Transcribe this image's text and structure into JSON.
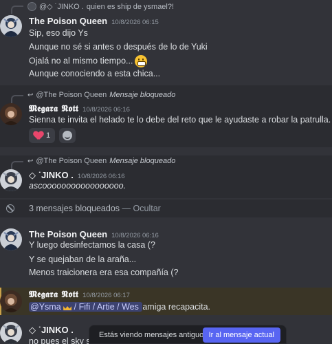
{
  "messages": {
    "m1": {
      "reply_author": "@◇ ˙JINKO .",
      "reply_text": "quien es ship de ysmael?!",
      "author": "The Poison Queen",
      "timestamp": "10/8/2026 06:15",
      "lines": [
        "Sip, eso dijo Ys",
        "Aunque no sé si antes o después de lo de Yuki",
        "Ojalá no al mismo tiempo...",
        "Aunque conociendo a esta chica..."
      ],
      "emoji": "grimacing-face"
    },
    "m2": {
      "reply_author": "@The Poison Queen",
      "reply_text": "Mensaje bloqueado",
      "author": "𝕸𝖊𝖌𝖆𝖗𝖆 𝕹𝖔𝖙𝖙",
      "timestamp": "10/8/2026 06:16",
      "text": "Sienna te invita el helado te lo debe del reto que le ayudaste a robar la patrulla.",
      "reactions": [
        {
          "emoji": "sparkling-heart",
          "count": "1"
        },
        {
          "emoji": "add-reaction",
          "count": ""
        }
      ]
    },
    "m3": {
      "reply_author": "@The Poison Queen",
      "reply_text": "Mensaje bloqueado",
      "author": "◇ ˙JINKO .",
      "timestamp": "10/8/2026 06:16",
      "text": "ascooooooooooooooooo."
    },
    "blocked": {
      "text": "3 mensajes bloqueados",
      "separator": "—",
      "action": "Ocultar"
    },
    "m4": {
      "author": "The Poison Queen",
      "timestamp": "10/8/2026 06:16",
      "lines": [
        "Y luego desinfectamos la casa (?",
        "Y se quejaban de la araña...",
        "Menos traicionera era esa compañía (?"
      ]
    },
    "m5": {
      "author": "𝕸𝖊𝖌𝖆𝖗𝖆 𝕹𝖔𝖙𝖙",
      "timestamp": "10/8/2026 06:17",
      "mention": "@Ysma",
      "mention_rest": "/ Fifi / Artie / Wes",
      "text": "amiga recapacita."
    },
    "m6": {
      "author": "◇ ˙JINKO .",
      "text_partial": "no pues el sky se"
    }
  },
  "banner": {
    "text": "Estás viendo mensajes antiguos",
    "button": "Ir al mensaje actual"
  },
  "colors": {
    "background": "#323339",
    "accent": "#5865f2",
    "mention_highlight": "#3a3526"
  }
}
